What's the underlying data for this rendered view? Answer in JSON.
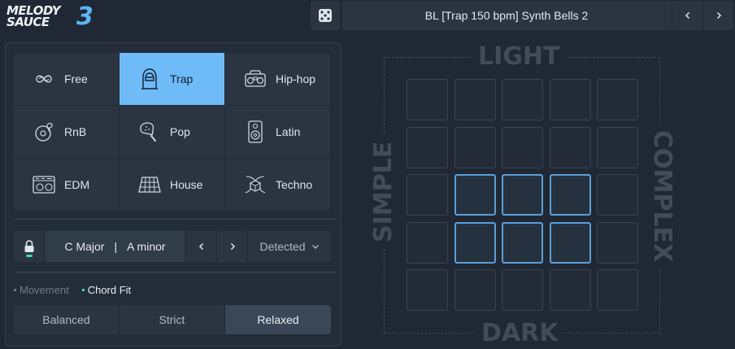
{
  "header": {
    "logo_line1": "MELODY",
    "logo_line2": "SAUCE",
    "logo_version": "3",
    "preset_name": "BL  [Trap 150 bpm]  Synth Bells 2"
  },
  "genres": [
    {
      "label": "Free",
      "icon": "infinity-icon"
    },
    {
      "label": "Trap",
      "icon": "hooded-figure-icon"
    },
    {
      "label": "Hip-hop",
      "icon": "boombox-icon"
    },
    {
      "label": "RnB",
      "icon": "vinyl-rose-icon"
    },
    {
      "label": "Pop",
      "icon": "popsicle-icon"
    },
    {
      "label": "Latin",
      "icon": "speaker-icon"
    },
    {
      "label": "EDM",
      "icon": "mixer-icon"
    },
    {
      "label": "House",
      "icon": "keyboard-icon"
    },
    {
      "label": "Techno",
      "icon": "cube-swirl-icon"
    }
  ],
  "selected_genre": "Trap",
  "key": {
    "major": "C Major",
    "separator": "|",
    "minor": "A minor",
    "detect_label": "Detected"
  },
  "mode_tabs": [
    {
      "label": "Movement",
      "active": false
    },
    {
      "label": "Chord Fit",
      "active": true
    }
  ],
  "fit_options": [
    "Balanced",
    "Strict",
    "Relaxed"
  ],
  "selected_fit": "Relaxed",
  "pad": {
    "top_label": "LIGHT",
    "bottom_label": "DARK",
    "left_label": "SIMPLE",
    "right_label": "COMPLEX",
    "rows": 5,
    "cols": 5,
    "active_cells": [
      [
        2,
        1
      ],
      [
        2,
        2
      ],
      [
        2,
        3
      ],
      [
        3,
        1
      ],
      [
        3,
        2
      ],
      [
        3,
        3
      ]
    ]
  },
  "colors": {
    "accent": "#6fbbf8",
    "active_indicator": "#3ed6b0",
    "pad_active_border": "#5c9fd8",
    "background": "#1f2834"
  }
}
